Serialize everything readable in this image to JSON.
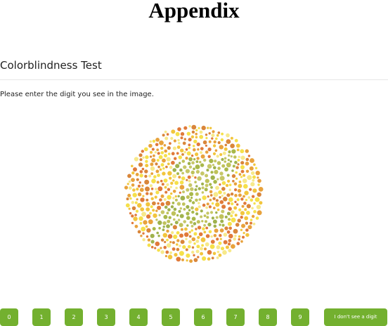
{
  "page": {
    "heading": "Appendix"
  },
  "test": {
    "title": "Colorblindness Test",
    "instruction": "Please enter the digit you see in the image."
  },
  "plate": {
    "dot_colors": [
      "#e8a23c",
      "#f2c53d",
      "#f5e04a",
      "#d9863a",
      "#f7e98a",
      "#e07a3a"
    ],
    "figure_dot_colors": [
      "#a8b84a",
      "#bfc25a",
      "#9fb24d",
      "#c6c767"
    ]
  },
  "answers": {
    "digits": [
      "0",
      "1",
      "2",
      "3",
      "4",
      "5",
      "6",
      "7",
      "8",
      "9"
    ],
    "no_digit_label": "I don't see a digit",
    "button_color": "#73b02f"
  }
}
